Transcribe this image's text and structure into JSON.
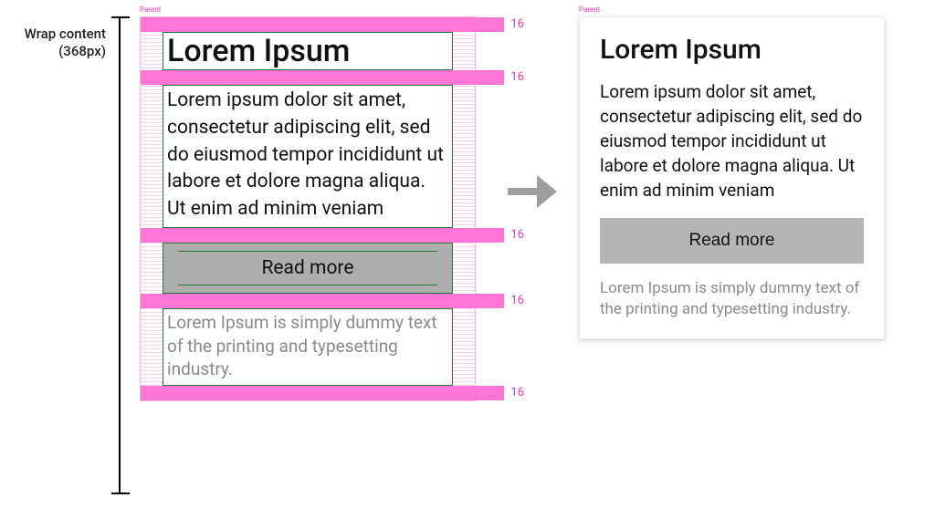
{
  "dimension": {
    "label_line1": "Wrap content",
    "label_line2": "(368px)"
  },
  "parent_label": "Parent",
  "spacer_value": "16",
  "content": {
    "title": "Lorem Ipsum",
    "body": "Lorem ipsum dolor sit amet, consectetur adipiscing elit, sed do eiusmod tempor incididunt ut labore et dolore magna aliqua. Ut enim ad minim veniam",
    "button_label": "Read more",
    "footer": "Lorem Ipsum is simply dummy text of the printing and typesetting industry."
  }
}
